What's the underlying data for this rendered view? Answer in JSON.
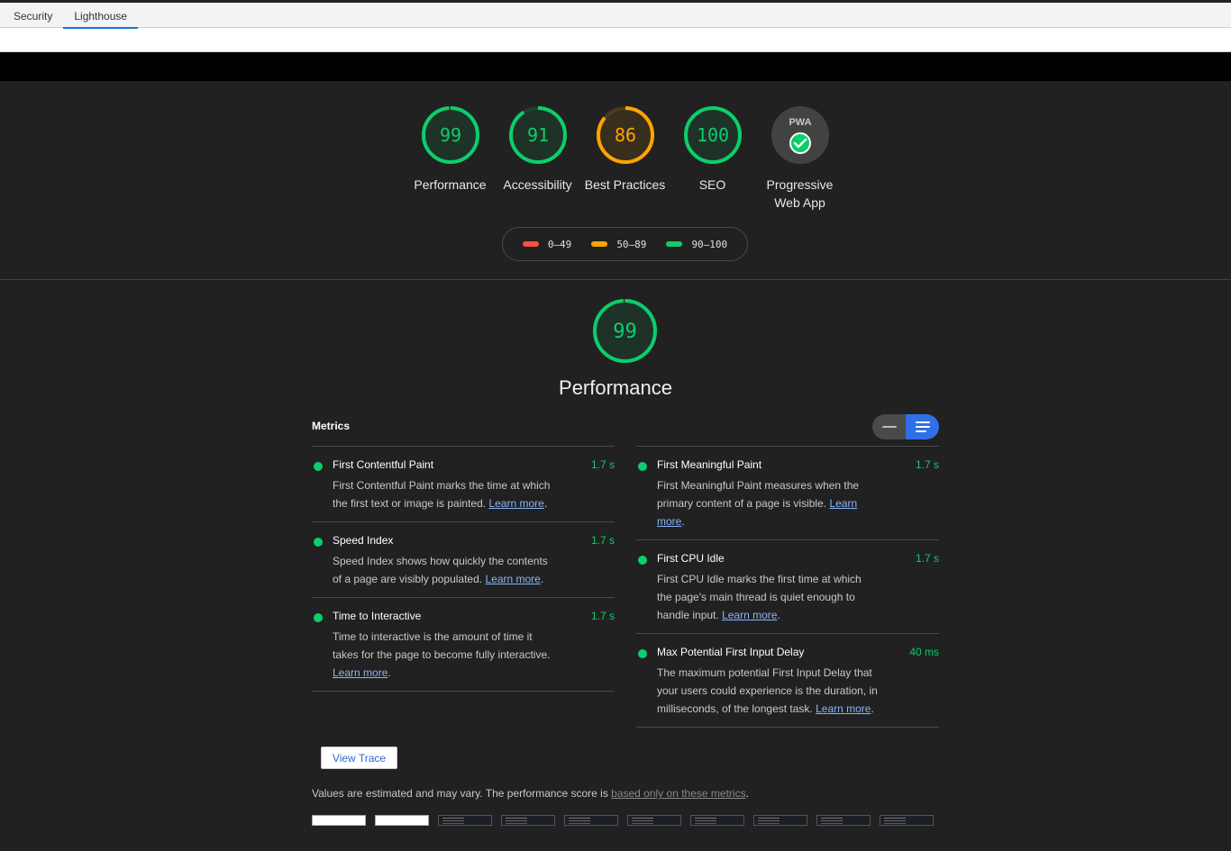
{
  "tabs": [
    {
      "label": "Security",
      "active": false
    },
    {
      "label": "Lighthouse",
      "active": true
    }
  ],
  "categories": [
    {
      "key": "performance",
      "score": "99",
      "score_fraction": 0.99,
      "label": "Performance",
      "status": "pass"
    },
    {
      "key": "accessibility",
      "score": "91",
      "score_fraction": 0.91,
      "label": "Accessibility",
      "status": "pass"
    },
    {
      "key": "best-practices",
      "score": "86",
      "score_fraction": 0.86,
      "label": "Best Practices",
      "status": "average"
    },
    {
      "key": "seo",
      "score": "100",
      "score_fraction": 1.0,
      "label": "SEO",
      "status": "pass"
    },
    {
      "key": "pwa",
      "badge_text": "PWA",
      "label": "Progressive Web App",
      "icon": "check-circle-icon"
    }
  ],
  "legend": [
    {
      "range": "0–49",
      "color": "#ff4e42"
    },
    {
      "range": "50–89",
      "color": "#ffa400"
    },
    {
      "range": "90–100",
      "color": "#0cce6b"
    }
  ],
  "colors": {
    "pass": "#0cce6b",
    "average": "#ffa400",
    "fail": "#ff4e42",
    "accent": "#2f6fe8"
  },
  "performance": {
    "score": "99",
    "score_fraction": 0.99,
    "title": "Performance",
    "metrics_title": "Metrics",
    "view_toggle": {
      "options": [
        "compact",
        "expanded"
      ],
      "selected": "expanded"
    },
    "metrics_left": [
      {
        "name": "First Contentful Paint",
        "value": "1.7 s",
        "desc": "First Contentful Paint marks the time at which the first text or image is painted.",
        "link": "Learn more"
      },
      {
        "name": "Speed Index",
        "value": "1.7 s",
        "desc": "Speed Index shows how quickly the contents of a page are visibly populated.",
        "link": "Learn more"
      },
      {
        "name": "Time to Interactive",
        "value": "1.7 s",
        "desc": "Time to interactive is the amount of time it takes for the page to become fully interactive.",
        "link": "Learn more"
      }
    ],
    "metrics_right": [
      {
        "name": "First Meaningful Paint",
        "value": "1.7 s",
        "desc": "First Meaningful Paint measures when the primary content of a page is visible.",
        "link": "Learn more"
      },
      {
        "name": "First CPU Idle",
        "value": "1.7 s",
        "desc": "First CPU Idle marks the first time at which the page's main thread is quiet enough to handle input.",
        "link": "Learn more"
      },
      {
        "name": "Max Potential First Input Delay",
        "value": "40 ms",
        "desc": "The maximum potential First Input Delay that your users could experience is the duration, in milliseconds, of the longest task.",
        "link": "Learn more"
      }
    ],
    "view_trace_label": "View Trace",
    "note_text": "Values are estimated and may vary. The performance score is ",
    "note_link": "based only on these metrics",
    "note_end": ".",
    "filmstrip": [
      "white",
      "white",
      "dark",
      "dark",
      "dark",
      "dark",
      "dark",
      "dark",
      "dark",
      "dark"
    ]
  }
}
